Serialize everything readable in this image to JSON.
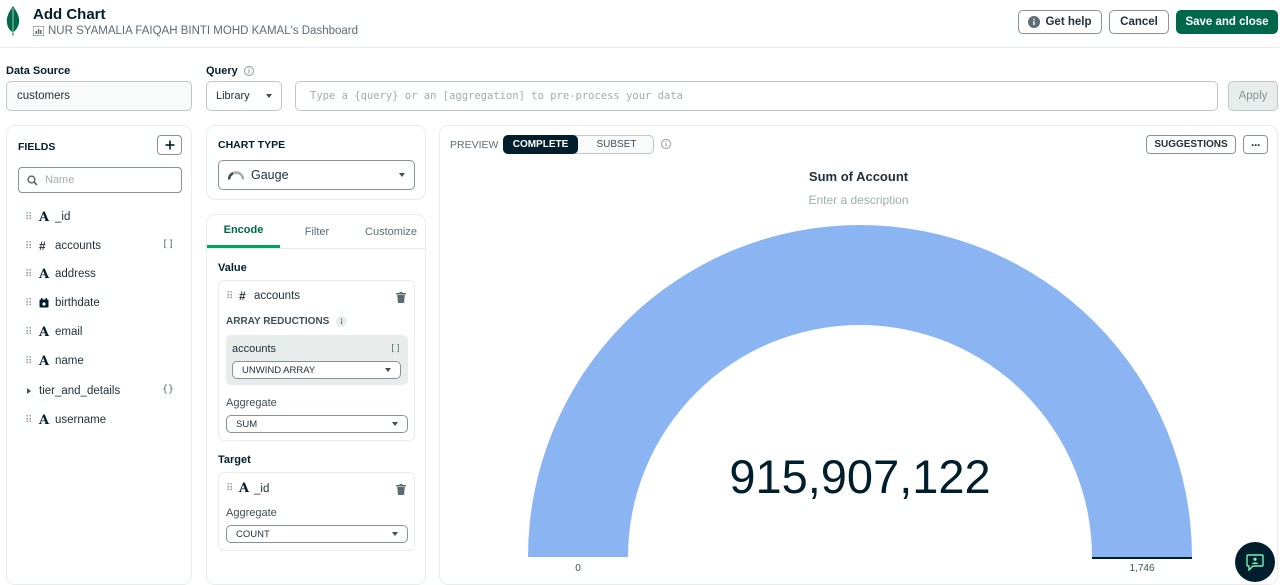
{
  "header": {
    "title": "Add Chart",
    "dashboard": "NUR SYAMALIA FAIQAH BINTI MOHD KAMAL's Dashboard",
    "help_label": "Get help",
    "cancel_label": "Cancel",
    "save_label": "Save and close"
  },
  "query_bar": {
    "data_source_label": "Data Source",
    "data_source_value": "customers",
    "query_label": "Query",
    "library_label": "Library",
    "query_placeholder": "Type a {query} or an [aggregation] to pre-process your data",
    "apply_label": "Apply"
  },
  "fields_panel": {
    "title": "FIELDS",
    "search_placeholder": "Name",
    "fields": [
      {
        "name": "_id",
        "type": "A",
        "badge": ""
      },
      {
        "name": "accounts",
        "type": "#",
        "badge": "[]"
      },
      {
        "name": "address",
        "type": "A",
        "badge": ""
      },
      {
        "name": "birthdate",
        "type": "date",
        "badge": ""
      },
      {
        "name": "email",
        "type": "A",
        "badge": ""
      },
      {
        "name": "name",
        "type": "A",
        "badge": ""
      },
      {
        "name": "tier_and_details",
        "type": "object",
        "badge": "{}"
      },
      {
        "name": "username",
        "type": "A",
        "badge": ""
      }
    ]
  },
  "chart_type": {
    "label": "CHART TYPE",
    "value": "Gauge"
  },
  "encode": {
    "tabs": [
      "Encode",
      "Filter",
      "Customize"
    ],
    "value_label": "Value",
    "value_field": "accounts",
    "array_reductions_label": "ARRAY REDUCTIONS",
    "reduction_field": "accounts",
    "reduction_badge": "[]",
    "reduction_value": "UNWIND ARRAY",
    "aggregate_label": "Aggregate",
    "value_aggregate": "SUM",
    "target_label": "Target",
    "target_field": "_id",
    "target_aggregate_label": "Aggregate",
    "target_aggregate": "COUNT"
  },
  "preview": {
    "label": "PREVIEW",
    "tab_complete": "COMPLETE",
    "tab_subset": "SUBSET",
    "suggestions_label": "SUGGESTIONS",
    "more_label": "···"
  },
  "chart_data": {
    "type": "gauge",
    "title": "Sum of Account",
    "description_placeholder": "Enter a description",
    "value": 915907122,
    "value_label": "915,907,122",
    "min": 0,
    "max": 1746,
    "min_label": "0",
    "max_label": "1,746",
    "fill_color": "#8ab5f2",
    "target_marker_color": "#001e2b"
  }
}
